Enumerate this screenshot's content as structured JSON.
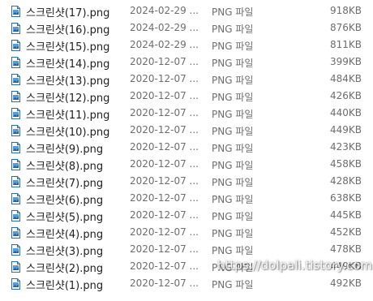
{
  "files": [
    {
      "name": "스크린샷(17).png",
      "modified": "2024-02-29 ...",
      "type": "PNG 파일",
      "size": "918KB"
    },
    {
      "name": "스크린샷(16).png",
      "modified": "2024-02-29 ...",
      "type": "PNG 파일",
      "size": "876KB"
    },
    {
      "name": "스크린샷(15).png",
      "modified": "2024-02-29 ...",
      "type": "PNG 파일",
      "size": "811KB"
    },
    {
      "name": "스크린샷(14).png",
      "modified": "2020-12-07 ...",
      "type": "PNG 파일",
      "size": "399KB"
    },
    {
      "name": "스크린샷(13).png",
      "modified": "2020-12-07 ...",
      "type": "PNG 파일",
      "size": "484KB"
    },
    {
      "name": "스크린샷(12).png",
      "modified": "2020-12-07 ...",
      "type": "PNG 파일",
      "size": "426KB"
    },
    {
      "name": "스크린샷(11).png",
      "modified": "2020-12-07 ...",
      "type": "PNG 파일",
      "size": "440KB"
    },
    {
      "name": "스크린샷(10).png",
      "modified": "2020-12-07 ...",
      "type": "PNG 파일",
      "size": "449KB"
    },
    {
      "name": "스크린샷(9).png",
      "modified": "2020-12-07 ...",
      "type": "PNG 파일",
      "size": "423KB"
    },
    {
      "name": "스크린샷(8).png",
      "modified": "2020-12-07 ...",
      "type": "PNG 파일",
      "size": "458KB"
    },
    {
      "name": "스크린샷(7).png",
      "modified": "2020-12-07 ...",
      "type": "PNG 파일",
      "size": "428KB"
    },
    {
      "name": "스크린샷(6).png",
      "modified": "2020-12-07 ...",
      "type": "PNG 파일",
      "size": "638KB"
    },
    {
      "name": "스크린샷(5).png",
      "modified": "2020-12-07 ...",
      "type": "PNG 파일",
      "size": "445KB"
    },
    {
      "name": "스크린샷(4).png",
      "modified": "2020-12-07 ...",
      "type": "PNG 파일",
      "size": "452KB"
    },
    {
      "name": "스크린샷(3).png",
      "modified": "2020-12-07 ...",
      "type": "PNG 파일",
      "size": "478KB"
    },
    {
      "name": "스크린샷(2).png",
      "modified": "2020-12-07 ...",
      "type": "PNG 파일",
      "size": "449KB"
    },
    {
      "name": "스크린샷(1).png",
      "modified": "2020-12-07 ...",
      "type": "PNG 파일",
      "size": "492KB"
    }
  ],
  "file_icon": "image-file-icon",
  "watermark": "https://dolpali.tistory.com",
  "colors": {
    "icon_blue": "#2b6cb0",
    "text": "#1e1e1e",
    "muted": "#6d6d6d"
  }
}
